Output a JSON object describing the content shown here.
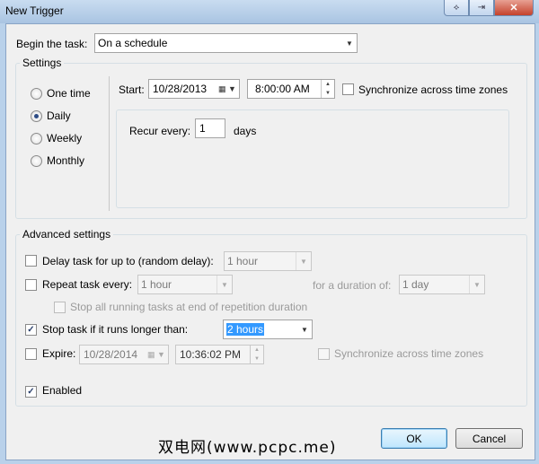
{
  "window": {
    "title": "New Trigger",
    "buttons": {
      "help_icon": "help-icon",
      "restore_icon": "restore-icon",
      "close_icon": "close-icon"
    }
  },
  "begin_task": {
    "label": "Begin the task:",
    "value": "On a schedule"
  },
  "settings": {
    "group_title": "Settings",
    "radios": [
      {
        "label": "One time",
        "checked": false
      },
      {
        "label": "Daily",
        "checked": true
      },
      {
        "label": "Weekly",
        "checked": false
      },
      {
        "label": "Monthly",
        "checked": false
      }
    ],
    "start_label": "Start:",
    "start_date": "10/28/2013",
    "start_time": "8:00:00 AM",
    "sync_label": "Synchronize across time zones",
    "sync_checked": false,
    "recur_label": "Recur every:",
    "recur_value": "1",
    "recur_unit": "days"
  },
  "advanced": {
    "group_title": "Advanced settings",
    "delay": {
      "label": "Delay task for up to (random delay):",
      "value": "1 hour",
      "checked": false
    },
    "repeat": {
      "label": "Repeat task every:",
      "value": "1 hour",
      "checked": false,
      "duration_label": "for a duration of:",
      "duration_value": "1 day"
    },
    "stop_all_label": "Stop all running tasks at end of repetition duration",
    "stop_longer": {
      "label": "Stop task if it runs longer than:",
      "value": "2 hours",
      "checked": true
    },
    "expire": {
      "label": "Expire:",
      "date": "10/28/2014",
      "time": "10:36:02 PM",
      "checked": false,
      "sync_label": "Synchronize across time zones"
    },
    "enabled": {
      "label": "Enabled",
      "checked": true
    }
  },
  "footer": {
    "watermark": "双电网(www.pcpc.me)",
    "ok_label": "OK",
    "cancel_label": "Cancel"
  },
  "glyphs": {
    "check": "✓",
    "arrow": "▼",
    "up": "▲",
    "down": "▼",
    "calendar": "▦"
  }
}
